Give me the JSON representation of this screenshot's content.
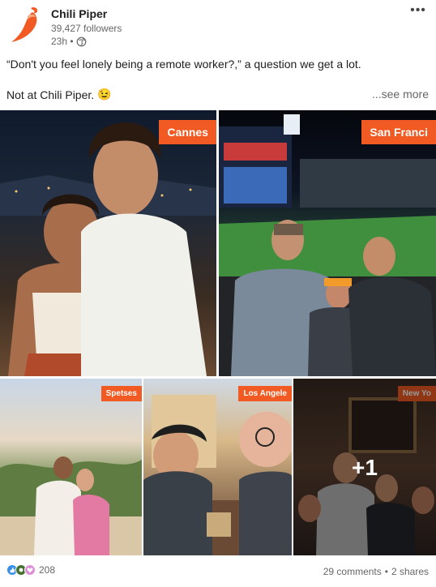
{
  "header": {
    "company": "Chili Piper",
    "followers": "39,427 followers",
    "time": "23h •",
    "more_label": "•••"
  },
  "post": {
    "line1": "“Don't you feel lonely being a remote worker?,” a question we get a lot.",
    "line2": "Not at Chili Piper.",
    "emoji": "😉",
    "see_more": "...see more"
  },
  "photos": [
    {
      "tag": "Cannes"
    },
    {
      "tag": "San Franci"
    },
    {
      "tag": "Spetses"
    },
    {
      "tag": "Los Angele"
    },
    {
      "tag": "New Yo",
      "more": "+1"
    }
  ],
  "footer": {
    "reaction_count": "208",
    "comments": "29 comments",
    "separator": "•",
    "shares": "2 shares"
  },
  "colors": {
    "brand_orange": "#f15a22",
    "like_blue": "#378fe9",
    "celebrate_green": "#44712e",
    "support_purple": "#dc91d6"
  }
}
